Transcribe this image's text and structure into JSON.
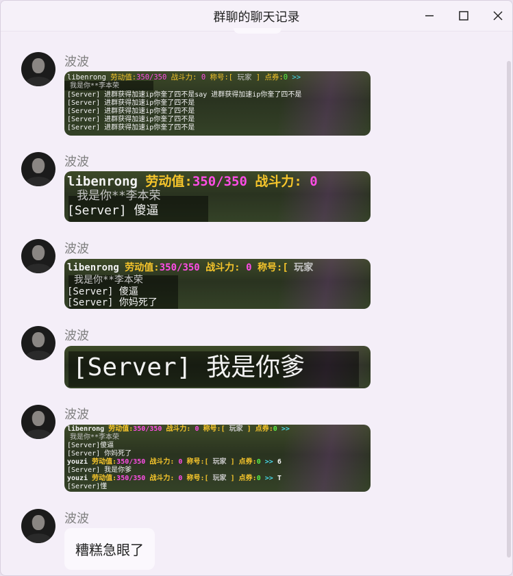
{
  "window": {
    "title": "群聊的聊天记录"
  },
  "messages": [
    {
      "sender": "波波",
      "lines": [
        {
          "player": "libenrong",
          "labor_label": "劳动值:",
          "labor": "350/350",
          "combat_label": "战斗力:",
          "combat": "0",
          "title_label": "称号:[",
          "title_val": "玩家",
          "title_end": "]",
          "coupon_label": "点券:",
          "coupon": "0",
          "arrows": ">>"
        },
        {
          "text": "我是你**李本荣"
        },
        {
          "text": "[Server] 进群获得加速ip你奎了四不是say 进群获得加速ip你奎了四不是"
        },
        {
          "text": "[Server] 进群获得加速ip你奎了四不是"
        },
        {
          "text": "[Server] 进群获得加速ip你奎了四不是"
        },
        {
          "text": "[Server] 进群获得加速ip你奎了四不是"
        },
        {
          "text": "[Server] 进群获得加速ip你奎了四不是"
        }
      ]
    },
    {
      "sender": "波波",
      "lines": [
        {
          "player": "libenrong",
          "labor_label": "劳动值:",
          "labor": "350/350",
          "combat_label": "战斗力:",
          "combat": "0"
        },
        {
          "text": "我是你**李本荣"
        },
        {
          "text": "[Server] 傻逼"
        }
      ]
    },
    {
      "sender": "波波",
      "lines": [
        {
          "player": "libenrong",
          "labor_label": "劳动值:",
          "labor": "350/350",
          "combat_label": "战斗力:",
          "combat": "0",
          "title_label": "称号:[",
          "title_val": "玩家"
        },
        {
          "text": "我是你**李本荣"
        },
        {
          "text": "[Server] 傻逼"
        },
        {
          "text": "[Server] 你妈死了"
        }
      ]
    },
    {
      "sender": "波波",
      "lines": [
        {
          "text": "[Server] 我是你爹"
        }
      ]
    },
    {
      "sender": "波波",
      "lines": [
        {
          "player": "libenrong",
          "labor_label": "劳动值:",
          "labor": "350/350",
          "combat_label": "战斗力:",
          "combat": "0",
          "title_label": "称号:[",
          "title_val": "玩家",
          "title_end": "]",
          "coupon_label": "点券:",
          "coupon": "0",
          "arrows": ">>"
        },
        {
          "text": "我是你**李本荣"
        },
        {
          "text": "[Server]傻逼"
        },
        {
          "text": "[Server] 你妈死了"
        },
        {
          "player": "youzi",
          "labor_label": "劳动值:",
          "labor": "350/350",
          "combat_label": "战斗力:",
          "combat": "0",
          "title_label": "称号:[",
          "title_val": "玩家",
          "title_end": "]",
          "coupon_label": "点券:",
          "coupon": "0",
          "arrows": ">>",
          "suffix": "6"
        },
        {
          "text": "[Server] 我是你爹"
        },
        {
          "player": "youzi",
          "labor_label": "劳动值:",
          "labor": "350/350",
          "combat_label": "战斗力:",
          "combat": "0",
          "title_label": "称号:[",
          "title_val": "玩家",
          "title_end": "]",
          "coupon_label": "点券:",
          "coupon": "0",
          "arrows": ">>",
          "suffix": "T"
        },
        {
          "text": "[Server]懂"
        }
      ]
    },
    {
      "sender": "波波",
      "text": "糟糕急眼了"
    }
  ]
}
